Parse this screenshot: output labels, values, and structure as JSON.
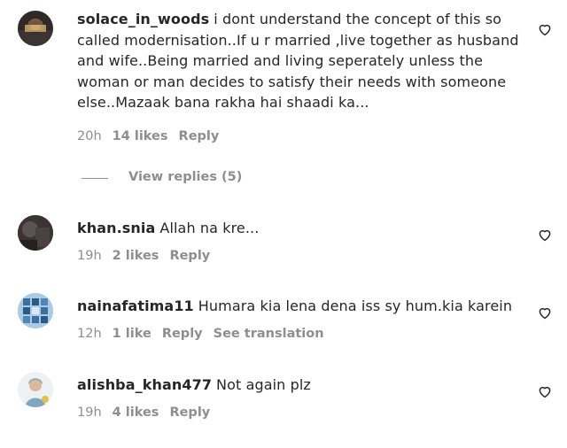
{
  "comments": [
    {
      "username": "solace_in_woods",
      "text": "i dont understand the concept of this so called modernisation..If u r married ,live together as husband and wife..Being married and living seperately unless the woman or man decides to satisfy their needs with someone else..Mazaak bana rakha hai shaadi ka...",
      "time": "20h",
      "likes": "14 likes",
      "reply": "Reply",
      "view_replies": "View replies (5)"
    },
    {
      "username": "khan.snia",
      "text": "Allah na kre...",
      "time": "19h",
      "likes": "2 likes",
      "reply": "Reply"
    },
    {
      "username": "nainafatima11",
      "text": "Humara kia lena dena iss sy hum.kia karein",
      "time": "12h",
      "likes": "1 like",
      "reply": "Reply",
      "translate": "See translation"
    },
    {
      "username": "alishba_khan477",
      "text": "Not again plz",
      "time": "19h",
      "likes": "4 likes",
      "reply": "Reply"
    }
  ],
  "icons": {
    "like": "heart-outline-icon"
  },
  "colors": {
    "text": "#262626",
    "meta": "#8e8e8e"
  }
}
